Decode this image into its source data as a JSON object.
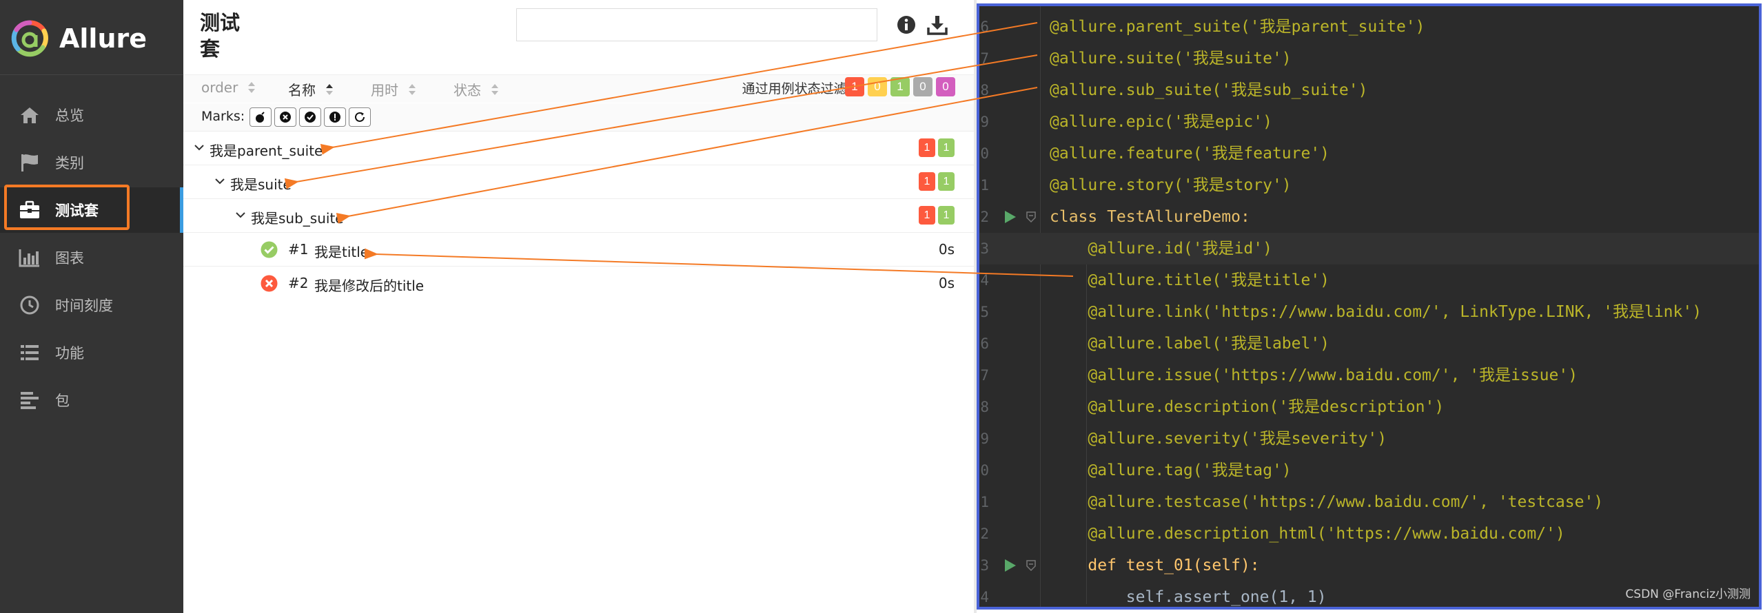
{
  "sidebar": {
    "brand": "Allure",
    "items": [
      {
        "label": "总览",
        "icon": "home-icon"
      },
      {
        "label": "类别",
        "icon": "flag-icon"
      },
      {
        "label": "测试套",
        "icon": "briefcase-icon",
        "active": true
      },
      {
        "label": "图表",
        "icon": "bar-chart-icon"
      },
      {
        "label": "时间刻度",
        "icon": "clock-icon"
      },
      {
        "label": "功能",
        "icon": "list-icon"
      },
      {
        "label": "包",
        "icon": "align-left-icon"
      }
    ]
  },
  "main": {
    "title": "测试套",
    "search_value": "",
    "sort": [
      "order",
      "名称",
      "用时",
      "状态"
    ],
    "filter_label": "通过用例状态过滤:",
    "filter_counts": {
      "failed": "1",
      "broken": "0",
      "passed": "1",
      "skipped": "0",
      "unknown": "0"
    },
    "marks_label": "Marks:",
    "tree": [
      {
        "label": "我是parent_suite",
        "failed": "1",
        "passed": "1"
      },
      {
        "label": "我是suite",
        "failed": "1",
        "passed": "1"
      },
      {
        "label": "我是sub_suite",
        "failed": "1",
        "passed": "1"
      }
    ],
    "cases": [
      {
        "num": "#1",
        "name": "我是title",
        "duration": "0s",
        "status": "passed"
      },
      {
        "num": "#2",
        "name": "我是修改后的title",
        "duration": "0s",
        "status": "failed"
      }
    ]
  },
  "editor": {
    "line_numbers": [
      "6",
      "7",
      "8",
      "9",
      "0",
      "1",
      "2",
      "3",
      "4",
      "5",
      "6",
      "7",
      "8",
      "9",
      "0",
      "1",
      "2",
      "3",
      "4"
    ],
    "lines": [
      "@allure.parent_suite('我是parent_suite')",
      "@allure.suite('我是suite')",
      "@allure.sub_suite('我是sub_suite')",
      "@allure.epic('我是epic')",
      "@allure.feature('我是feature')",
      "@allure.story('我是story')",
      "class TestAllureDemo:",
      "    @allure.id('我是id')",
      "    @allure.title('我是title')",
      "    @allure.link('https://www.baidu.com/', LinkType.LINK, '我是link')",
      "    @allure.label('我是label')",
      "    @allure.issue('https://www.baidu.com/', '我是issue')",
      "    @allure.description('我是description')",
      "    @allure.severity('我是severity')",
      "    @allure.tag('我是tag')",
      "    @allure.testcase('https://www.baidu.com/', 'testcase')",
      "    @allure.description_html('https://www.baidu.com/')",
      "    def test_01(self):",
      "        self.assert_one(1, 1)"
    ],
    "watermark": "CSDN @Franciz小测测"
  },
  "colors": {
    "sidebar_bg": "#343434",
    "accent_blue": "#3b9de1",
    "annotation_orange": "#f47a25",
    "failed": "#fd5a3e",
    "passed": "#97cc64",
    "ide_bg": "#2b2b2b",
    "ide_border": "#4a63d8"
  }
}
